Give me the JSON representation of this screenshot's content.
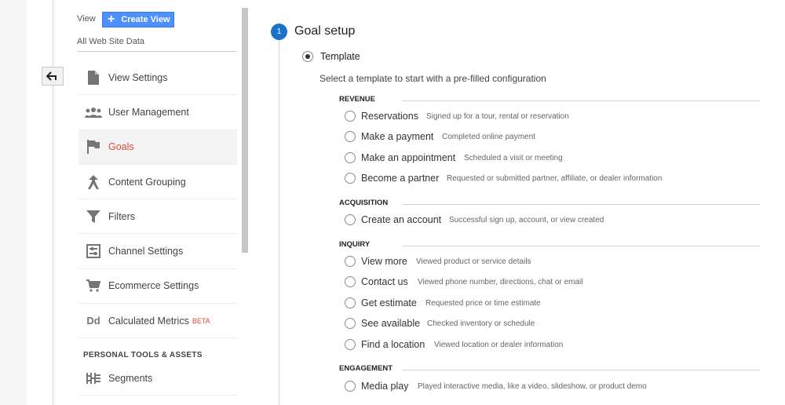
{
  "view_panel": {
    "view_label": "View",
    "create_view_label": "Create View",
    "view_data_name": "All Web Site Data"
  },
  "menu": {
    "items": [
      {
        "label": "View Settings",
        "icon": "document-icon"
      },
      {
        "label": "User Management",
        "icon": "users-icon"
      },
      {
        "label": "Goals",
        "icon": "flag-icon",
        "active": true
      },
      {
        "label": "Content Grouping",
        "icon": "grouping-icon"
      },
      {
        "label": "Filters",
        "icon": "filter-icon"
      },
      {
        "label": "Channel Settings",
        "icon": "channel-settings-icon"
      },
      {
        "label": "Ecommerce Settings",
        "icon": "cart-icon"
      },
      {
        "label": "Calculated Metrics",
        "icon": "dd-icon",
        "badge": "BETA"
      }
    ],
    "section_heading": "PERSONAL TOOLS & ASSETS",
    "personal_items": [
      {
        "label": "Segments",
        "icon": "segments-icon"
      }
    ]
  },
  "goal_setup": {
    "step_number": "1",
    "title": "Goal setup",
    "template_label": "Template",
    "instructions": "Select a template to start with a pre-filled configuration",
    "categories": [
      {
        "name": "REVENUE",
        "options": [
          {
            "name": "Reservations",
            "desc": "Signed up for a tour, rental or reservation"
          },
          {
            "name": "Make a payment",
            "desc": "Completed online payment"
          },
          {
            "name": "Make an appointment",
            "desc": "Scheduled a visit or meeting"
          },
          {
            "name": "Become a partner",
            "desc": "Requested or submitted partner, affiliate, or dealer information"
          }
        ]
      },
      {
        "name": "ACQUISITION",
        "options": [
          {
            "name": "Create an account",
            "desc": "Successful sign up, account, or view created"
          }
        ]
      },
      {
        "name": "INQUIRY",
        "options": [
          {
            "name": "View more",
            "desc": "Viewed product or service details"
          },
          {
            "name": "Contact us",
            "desc": "Viewed phone number, directions, chat or email"
          },
          {
            "name": "Get estimate",
            "desc": "Requested price or time estimate"
          },
          {
            "name": "See available",
            "desc": "Checked inventory or schedule"
          },
          {
            "name": "Find a location",
            "desc": "Viewed location or dealer information"
          }
        ]
      },
      {
        "name": "ENGAGEMENT",
        "options": [
          {
            "name": "Media play",
            "desc": "Played interactive media, like a video, slideshow, or product demo"
          }
        ]
      }
    ]
  },
  "colors": {
    "accent_blue": "#4d90fe",
    "step_blue": "#1a73c9",
    "active_red": "#dd4b39"
  }
}
